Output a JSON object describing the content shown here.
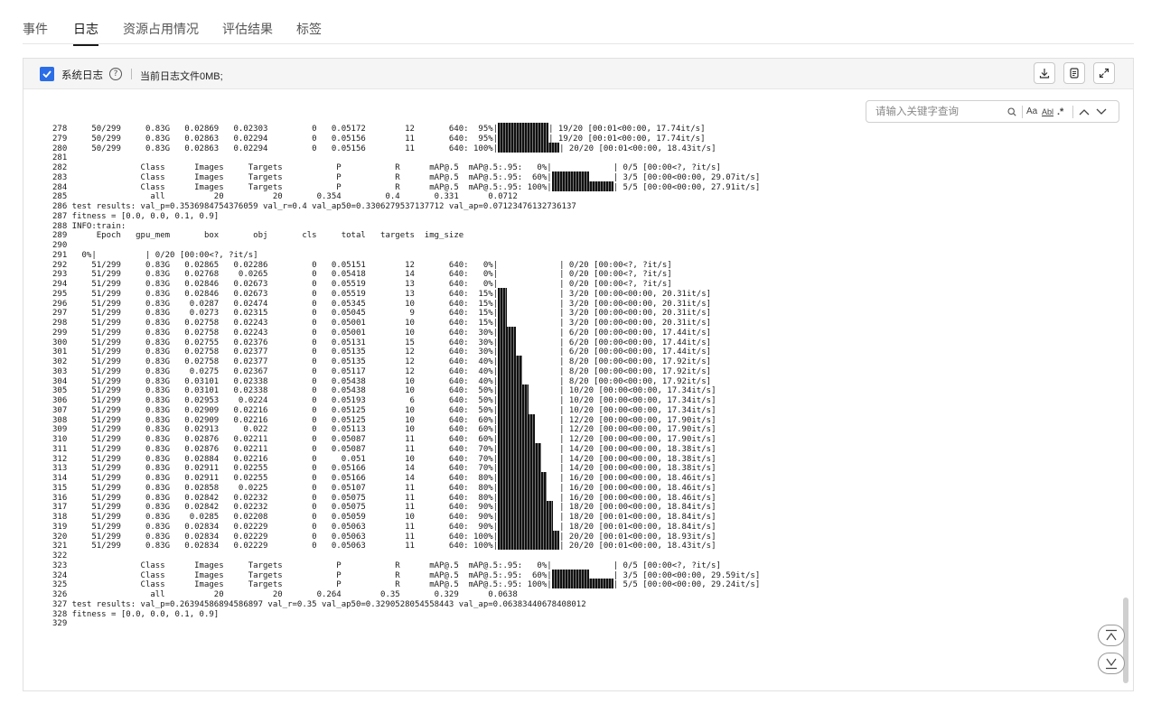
{
  "tabs": [
    "事件",
    "日志",
    "资源占用情况",
    "评估结果",
    "标签"
  ],
  "active_tab": "日志",
  "toolbar": {
    "system_log_label": "系统日志",
    "help_symbol": "?",
    "file_size_text": "当前日志文件0MB;"
  },
  "search": {
    "placeholder": "请输入关键字查询",
    "match_case": "Aa",
    "whole_word": "Abl",
    "regex": ".*"
  },
  "icons": [
    "download-icon",
    "document-icon",
    "expand-icon",
    "search-icon",
    "chevron-up-icon",
    "chevron-down-icon",
    "scroll-top-icon",
    "scroll-bottom-icon"
  ],
  "colors": {
    "accent": "#2b6de6",
    "active_tab": "#191919"
  },
  "log_lines": [
    {
      "text": "278     50/299     0.83G   0.02869   0.02303         0   0.05172        12       640:  95%|",
      "bar": 56,
      "tail": "| 19/20 [00:01<00:00, 17.74it/s]"
    },
    {
      "text": "279     50/299     0.83G   0.02863   0.02294         0   0.05156        11       640:  95%|",
      "bar": 56,
      "tail": "| 19/20 [00:01<00:00, 17.74it/s]"
    },
    {
      "text": "280     50/299     0.83G   0.02863   0.02294         0   0.05156        11       640: 100%|",
      "bar": 68,
      "tail": "| 20/20 [00:01<00:00, 18.43it/s]"
    },
    {
      "text": "281"
    },
    {
      "text": "282               Class      Images     Targets           P           R      mAP@.5  mAP@.5:.95:   0%|",
      "bar": 0,
      "pad": 68,
      "tail": "| 0/5 [00:00<?, ?it/s]"
    },
    {
      "text": "283               Class      Images     Targets           P           R      mAP@.5  mAP@.5:.95:  60%|",
      "bar": 41,
      "pad": 27,
      "tail": "| 3/5 [00:00<00:00, 29.07it/s]"
    },
    {
      "text": "284               Class      Images     Targets           P           R      mAP@.5  mAP@.5:.95: 100%|",
      "bar": 68,
      "tail": "| 5/5 [00:00<00:00, 27.91it/s]"
    },
    {
      "text": "285                 all          20          20       0.354         0.4       0.331      0.0712"
    },
    {
      "text": "286 test results: val_p=0.3536984754376059 val_r=0.4 val_ap50=0.3306279537137712 val_ap=0.07123476132736137"
    },
    {
      "text": "287 fitness = [0.0, 0.0, 0.1, 0.9]"
    },
    {
      "text": "288 INFO:train:"
    },
    {
      "text": "289      Epoch   gpu_mem       box       obj       cls     total   targets  img_size"
    },
    {
      "text": "290"
    },
    {
      "text": "291   0%|          | 0/20 [00:00<?, ?it/s]"
    },
    {
      "text": "292     51/299     0.83G   0.02865   0.02286         0   0.05151        12       640:   0%|",
      "bar": 0,
      "pad": 68,
      "tail": "| 0/20 [00:00<?, ?it/s]"
    },
    {
      "text": "293     51/299     0.83G   0.02768    0.0265         0   0.05418        14       640:   0%|",
      "bar": 0,
      "pad": 68,
      "tail": "| 0/20 [00:00<?, ?it/s]"
    },
    {
      "text": "294     51/299     0.83G   0.02846   0.02673         0   0.05519        13       640:   0%|",
      "bar": 0,
      "pad": 68,
      "tail": "| 0/20 [00:00<?, ?it/s]"
    },
    {
      "text": "295     51/299     0.83G   0.02846   0.02673         0   0.05519        13       640:  15%|",
      "bar": 10,
      "pad": 58,
      "tail": "| 3/20 [00:00<00:00, 20.31it/s]"
    },
    {
      "text": "296     51/299     0.83G    0.0287   0.02474         0   0.05345        10       640:  15%|",
      "bar": 10,
      "pad": 58,
      "tail": "| 3/20 [00:00<00:00, 20.31it/s]"
    },
    {
      "text": "297     51/299     0.83G    0.0273   0.02315         0   0.05045         9       640:  15%|",
      "bar": 10,
      "pad": 58,
      "tail": "| 3/20 [00:00<00:00, 20.31it/s]"
    },
    {
      "text": "298     51/299     0.83G   0.02758   0.02243         0   0.05001        10       640:  15%|",
      "bar": 10,
      "pad": 58,
      "tail": "| 3/20 [00:00<00:00, 20.31it/s]"
    },
    {
      "text": "299     51/299     0.83G   0.02758   0.02243         0   0.05001        10       640:  30%|",
      "bar": 20,
      "pad": 48,
      "tail": "| 6/20 [00:00<00:00, 17.44it/s]"
    },
    {
      "text": "300     51/299     0.83G   0.02755   0.02376         0   0.05131        15       640:  30%|",
      "bar": 20,
      "pad": 48,
      "tail": "| 6/20 [00:00<00:00, 17.44it/s]"
    },
    {
      "text": "301     51/299     0.83G   0.02758   0.02377         0   0.05135        12       640:  30%|",
      "bar": 20,
      "pad": 48,
      "tail": "| 6/20 [00:00<00:00, 17.44it/s]"
    },
    {
      "text": "302     51/299     0.83G   0.02758   0.02377         0   0.05135        12       640:  40%|",
      "bar": 27,
      "pad": 41,
      "tail": "| 8/20 [00:00<00:00, 17.92it/s]"
    },
    {
      "text": "303     51/299     0.83G    0.0275   0.02367         0   0.05117        12       640:  40%|",
      "bar": 27,
      "pad": 41,
      "tail": "| 8/20 [00:00<00:00, 17.92it/s]"
    },
    {
      "text": "304     51/299     0.83G   0.03101   0.02338         0   0.05438        10       640:  40%|",
      "bar": 27,
      "pad": 41,
      "tail": "| 8/20 [00:00<00:00, 17.92it/s]"
    },
    {
      "text": "305     51/299     0.83G   0.03101   0.02338         0   0.05438        10       640:  50%|",
      "bar": 34,
      "pad": 34,
      "tail": "| 10/20 [00:00<00:00, 17.34it/s]"
    },
    {
      "text": "306     51/299     0.83G   0.02953    0.0224         0   0.05193         6       640:  50%|",
      "bar": 34,
      "pad": 34,
      "tail": "| 10/20 [00:00<00:00, 17.34it/s]"
    },
    {
      "text": "307     51/299     0.83G   0.02909   0.02216         0   0.05125        10       640:  50%|",
      "bar": 34,
      "pad": 34,
      "tail": "| 10/20 [00:00<00:00, 17.34it/s]"
    },
    {
      "text": "308     51/299     0.83G   0.02909   0.02216         0   0.05125        10       640:  60%|",
      "bar": 41,
      "pad": 27,
      "tail": "| 12/20 [00:00<00:00, 17.90it/s]"
    },
    {
      "text": "309     51/299     0.83G   0.02913     0.022         0   0.05113        10       640:  60%|",
      "bar": 41,
      "pad": 27,
      "tail": "| 12/20 [00:00<00:00, 17.90it/s]"
    },
    {
      "text": "310     51/299     0.83G   0.02876   0.02211         0   0.05087        11       640:  60%|",
      "bar": 41,
      "pad": 27,
      "tail": "| 12/20 [00:00<00:00, 17.90it/s]"
    },
    {
      "text": "311     51/299     0.83G   0.02876   0.02211         0   0.05087        11       640:  70%|",
      "bar": 48,
      "pad": 20,
      "tail": "| 14/20 [00:00<00:00, 18.38it/s]"
    },
    {
      "text": "312     51/299     0.83G   0.02884   0.02216         0     0.051        10       640:  70%|",
      "bar": 48,
      "pad": 20,
      "tail": "| 14/20 [00:00<00:00, 18.38it/s]"
    },
    {
      "text": "313     51/299     0.83G   0.02911   0.02255         0   0.05166        14       640:  70%|",
      "bar": 48,
      "pad": 20,
      "tail": "| 14/20 [00:00<00:00, 18.38it/s]"
    },
    {
      "text": "314     51/299     0.83G   0.02911   0.02255         0   0.05166        14       640:  80%|",
      "bar": 54,
      "pad": 14,
      "tail": "| 16/20 [00:00<00:00, 18.46it/s]"
    },
    {
      "text": "315     51/299     0.83G   0.02858    0.0225         0   0.05107        11       640:  80%|",
      "bar": 54,
      "pad": 14,
      "tail": "| 16/20 [00:00<00:00, 18.46it/s]"
    },
    {
      "text": "316     51/299     0.83G   0.02842   0.02232         0   0.05075        11       640:  80%|",
      "bar": 54,
      "pad": 14,
      "tail": "| 16/20 [00:00<00:00, 18.46it/s]"
    },
    {
      "text": "317     51/299     0.83G   0.02842   0.02232         0   0.05075        11       640:  90%|",
      "bar": 61,
      "pad": 7,
      "tail": "| 18/20 [00:00<00:00, 18.84it/s]"
    },
    {
      "text": "318     51/299     0.83G    0.0285   0.02208         0   0.05059        10       640:  90%|",
      "bar": 61,
      "pad": 7,
      "tail": "| 18/20 [00:01<00:00, 18.84it/s]"
    },
    {
      "text": "319     51/299     0.83G   0.02834   0.02229         0   0.05063        11       640:  90%|",
      "bar": 61,
      "pad": 7,
      "tail": "| 18/20 [00:01<00:00, 18.84it/s]"
    },
    {
      "text": "320     51/299     0.83G   0.02834   0.02229         0   0.05063        11       640: 100%|",
      "bar": 68,
      "tail": "| 20/20 [00:01<00:00, 18.93it/s]"
    },
    {
      "text": "321     51/299     0.83G   0.02834   0.02229         0   0.05063        11       640: 100%|",
      "bar": 68,
      "tail": "| 20/20 [00:01<00:00, 18.43it/s]"
    },
    {
      "text": "322"
    },
    {
      "text": "323               Class      Images     Targets           P           R      mAP@.5  mAP@.5:.95:   0%|",
      "bar": 0,
      "pad": 68,
      "tail": "| 0/5 [00:00<?, ?it/s]"
    },
    {
      "text": "324               Class      Images     Targets           P           R      mAP@.5  mAP@.5:.95:  60%|",
      "bar": 41,
      "pad": 27,
      "tail": "| 3/5 [00:00<00:00, 29.59it/s]"
    },
    {
      "text": "325               Class      Images     Targets           P           R      mAP@.5  mAP@.5:.95: 100%|",
      "bar": 68,
      "tail": "| 5/5 [00:00<00:00, 29.24it/s]"
    },
    {
      "text": "326                 all          20          20       0.264        0.35       0.329      0.0638"
    },
    {
      "text": "327 test results: val_p=0.26394586894586897 val_r=0.35 val_ap50=0.3290528054558443 val_ap=0.06383440678408012"
    },
    {
      "text": "328 fitness = [0.0, 0.0, 0.1, 0.9]"
    },
    {
      "text": "329"
    }
  ]
}
